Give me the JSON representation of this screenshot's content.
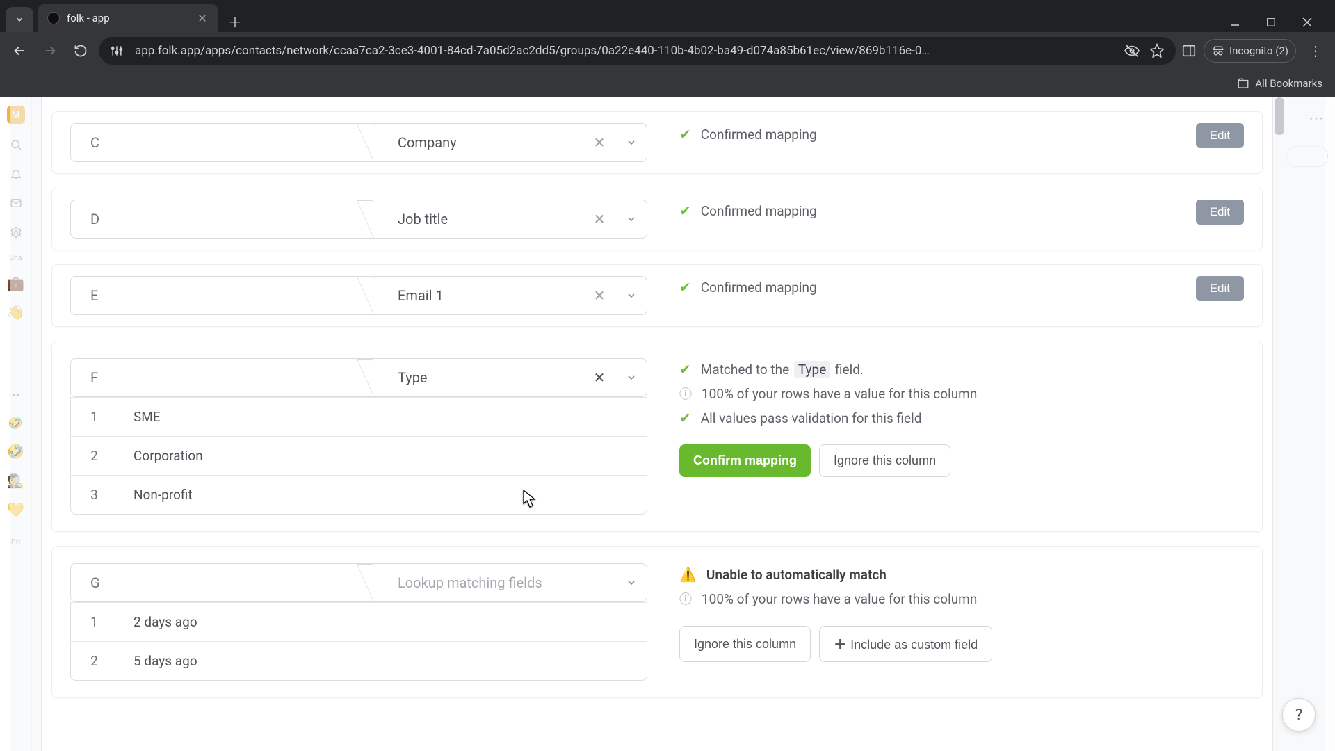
{
  "browser": {
    "tab_title": "folk - app",
    "url": "app.folk.app/apps/contacts/network/ccaa7ca2-3ce3-4001-84cd-7a05d2ac2dd5/groups/0a22e440-110b-4b02-ba49-d074a85b61ec/view/869b116e-0…",
    "incognito_label": "Incognito (2)",
    "all_bookmarks": "All Bookmarks"
  },
  "sidebar": {
    "avatar_initial": "M",
    "group_label_1": "Sha",
    "group_label_2": "Pri",
    "emojis": [
      "💼",
      "👋",
      "🤣",
      "🕵️",
      "💛"
    ]
  },
  "mappings": [
    {
      "letter": "C",
      "field": "Company",
      "status": {
        "type": "confirmed",
        "text": "Confirmed mapping"
      },
      "edit_label": "Edit",
      "preview": [],
      "show_clear": true,
      "placeholder": false
    },
    {
      "letter": "D",
      "field": "Job title",
      "status": {
        "type": "confirmed",
        "text": "Confirmed mapping"
      },
      "edit_label": "Edit",
      "preview": [],
      "show_clear": true,
      "placeholder": false
    },
    {
      "letter": "E",
      "field": "Email 1",
      "status": {
        "type": "confirmed",
        "text": "Confirmed mapping"
      },
      "edit_label": "Edit",
      "preview": [],
      "show_clear": true,
      "placeholder": false
    },
    {
      "letter": "F",
      "field": "Type",
      "status": {
        "type": "matched",
        "matched_prefix": "Matched to the",
        "matched_chip": "Type",
        "matched_suffix": "field.",
        "info_line": "100% of your rows have a value for this column",
        "valid_line": "All values pass validation for this field"
      },
      "actions": {
        "confirm": "Confirm mapping",
        "ignore": "Ignore this column"
      },
      "preview": [
        {
          "idx": "1",
          "val": "SME"
        },
        {
          "idx": "2",
          "val": "Corporation"
        },
        {
          "idx": "3",
          "val": "Non-profit"
        }
      ],
      "show_clear": true,
      "clear_dark": true,
      "placeholder": false
    },
    {
      "letter": "G",
      "field": "Lookup matching fields",
      "status": {
        "type": "unmatched",
        "warn_text": "Unable to automatically match",
        "info_line": "100% of your rows have a value for this column"
      },
      "actions": {
        "ignore": "Ignore this column",
        "include": "Include as custom field"
      },
      "preview": [
        {
          "idx": "1",
          "val": "2 days ago"
        },
        {
          "idx": "2",
          "val": "5 days ago"
        }
      ],
      "show_clear": false,
      "placeholder": true
    }
  ],
  "help_label": "?"
}
